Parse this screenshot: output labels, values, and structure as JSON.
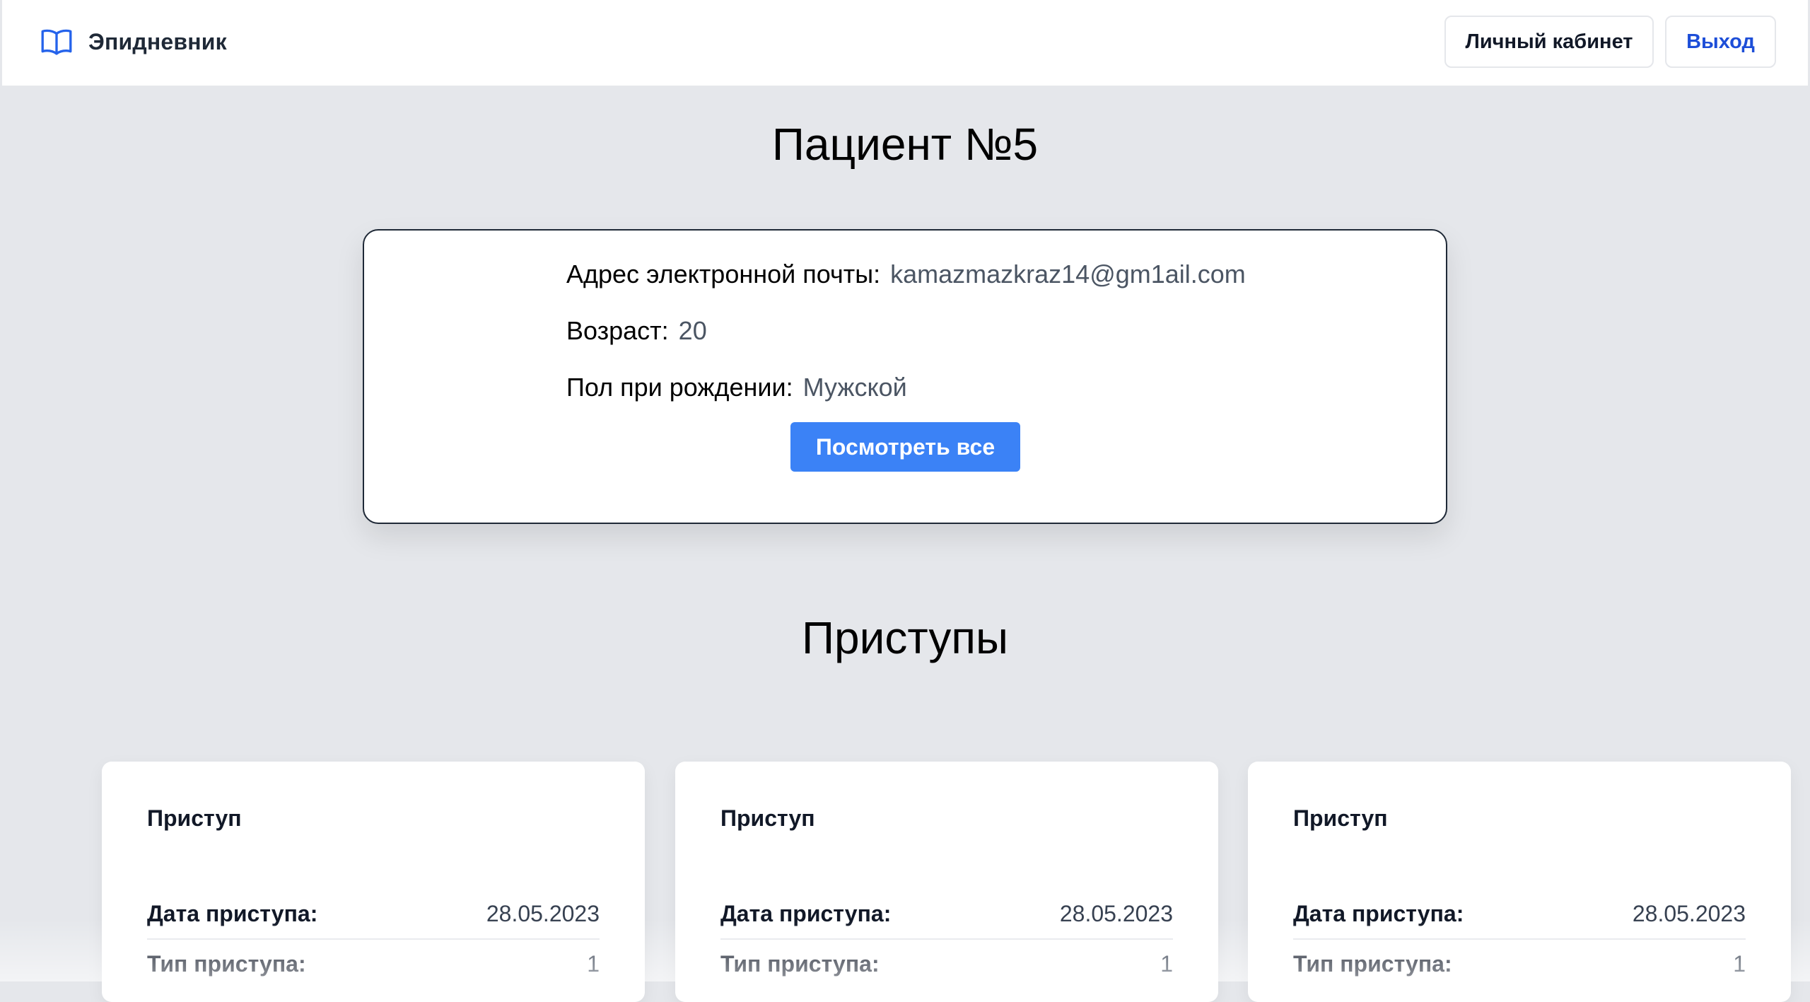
{
  "header": {
    "app_name": "Эпидневник",
    "logo_icon": "book-open-icon",
    "cabinet_label": "Личный кабинет",
    "exit_label": "Выход"
  },
  "page_title": "Пациент №5",
  "patient": {
    "email_label": "Адрес электронной почты:",
    "email_value": "kamazmazkraz14@gm1ail.com",
    "age_label": "Возраст:",
    "age_value": "20",
    "sex_label": "Пол при рождении:",
    "sex_value": "Мужской",
    "view_all_label": "Посмотреть все"
  },
  "seizures_title": "Приступы",
  "seizures": [
    {
      "title": "Приступ",
      "date_label": "Дата приступа:",
      "date_value": "28.05.2023",
      "type_label": "Тип приступа:",
      "type_value": "1"
    },
    {
      "title": "Приступ",
      "date_label": "Дата приступа:",
      "date_value": "28.05.2023",
      "type_label": "Тип приступа:",
      "type_value": "1"
    },
    {
      "title": "Приступ",
      "date_label": "Дата приступа:",
      "date_value": "28.05.2023",
      "type_label": "Тип приступа:",
      "type_value": "1"
    }
  ],
  "colors": {
    "background": "#e5e7eb",
    "accent": "#3b82f6",
    "link": "#1d4ed8"
  }
}
